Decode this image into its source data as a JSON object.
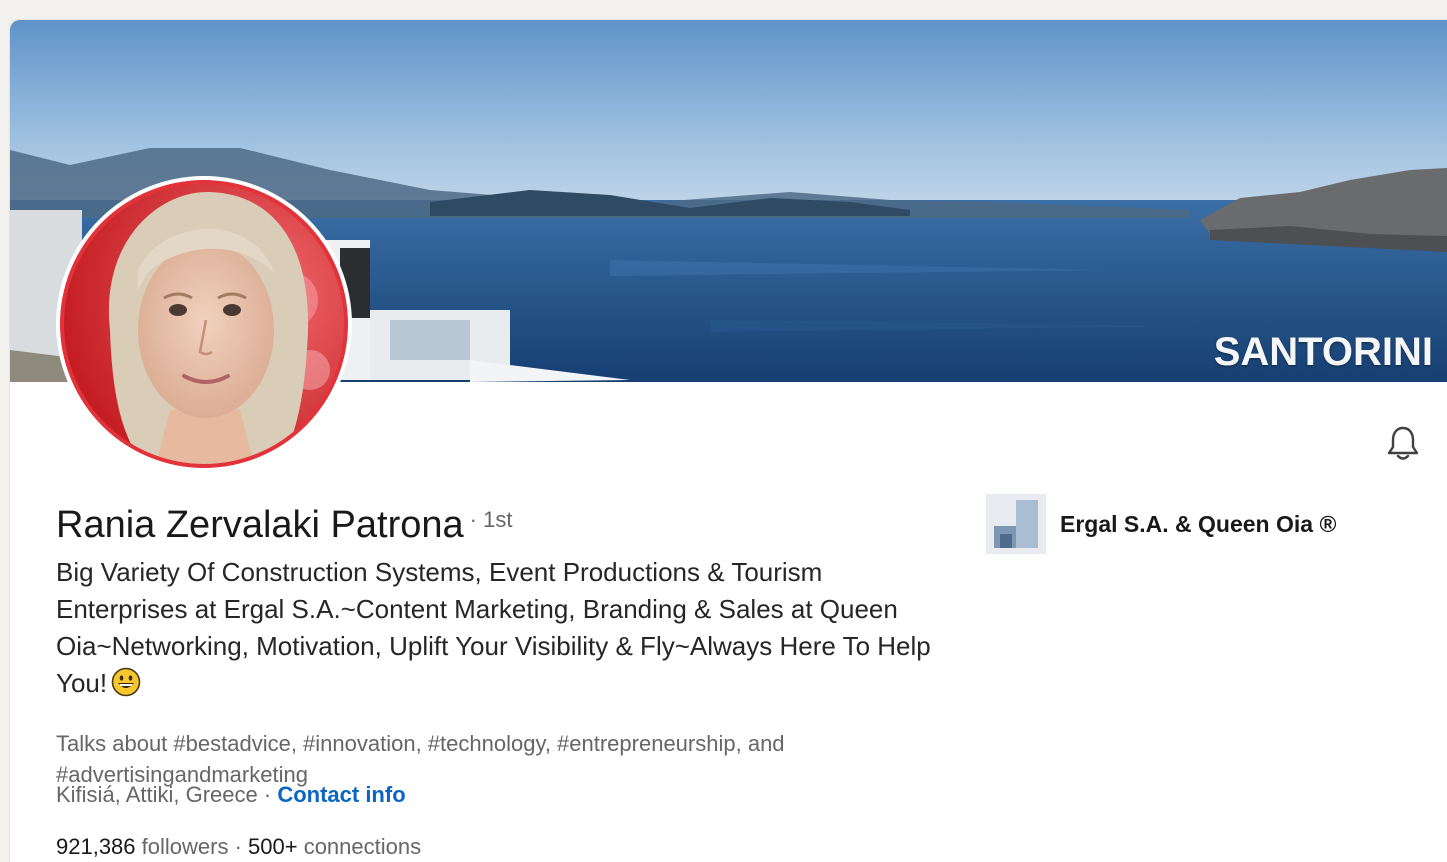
{
  "cover": {
    "caption": "SANTORINI"
  },
  "profile": {
    "name": "Rania Zervalaki Patrona",
    "degree": "· 1st",
    "headline": "Big Variety Of Construction Systems, Event Productions & Tourism Enterprises at Ergal S.A.~Content Marketing, Branding & Sales at Queen Oia~Networking, Motivation, Uplift Your Visibility & Fly~Always Here To Help You!",
    "headline_emoji": "grinning-face-emoji",
    "talks_about": "Talks about #bestadvice, #innovation, #technology, #entrepreneurship, and #advertisingandmarketing",
    "location": "Kifisiá, Attiki, Greece",
    "location_separator": " · ",
    "contact_info_label": "Contact info",
    "followers": "921,386",
    "followers_label": " followers",
    "connections_separator": " · ",
    "connections": "500+",
    "connections_label": " connections"
  },
  "company": {
    "name": "Ergal S.A. & Queen Oia ®"
  },
  "icons": {
    "notify": "bell-icon"
  },
  "colors": {
    "link": "#0a66c2",
    "avatar_ring": "#d7262c",
    "sea": "#1f4f86"
  }
}
